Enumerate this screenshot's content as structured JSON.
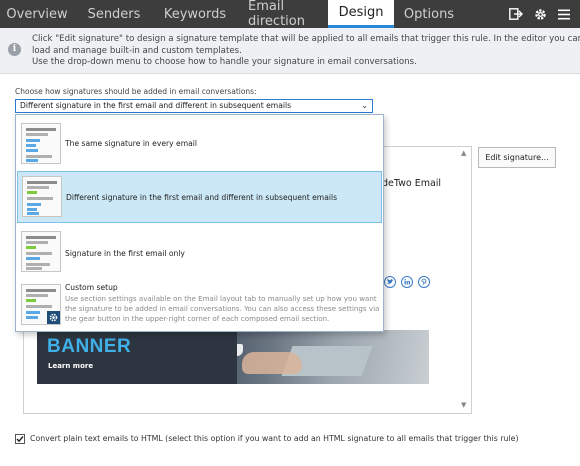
{
  "tabs": [
    {
      "label": "Overview"
    },
    {
      "label": "Senders"
    },
    {
      "label": "Keywords"
    },
    {
      "label": "Email direction"
    },
    {
      "label": "Design",
      "active": true
    },
    {
      "label": "Options"
    }
  ],
  "toolbar_icons": [
    "exit-icon",
    "gear-icon",
    "menu-icon"
  ],
  "info": {
    "line1": "Click \"Edit signature\" to design a signature template that will be applied to all emails that trigger this rule. In the editor you can also",
    "line2": "load and manage built-in and custom templates.",
    "line3": "Use the drop-down menu to choose how to handle your signature in email conversations."
  },
  "signature_mode": {
    "label": "Choose how signatures should be added in email conversations:",
    "selected": "Different signature in the first email and different in subsequent emails",
    "options": [
      {
        "label": "The same signature in every email"
      },
      {
        "label": "Different signature in the first email and different in subsequent emails"
      },
      {
        "label": "Signature in the first email only"
      },
      {
        "label": "Custom setup",
        "desc1": "Use section settings available on the Email layout tab to manually set up how you want",
        "desc2": "the signature to be added in email conversations. You can also access these settings via",
        "desc3": "the gear button in the upper-right corner of each composed email section."
      }
    ]
  },
  "preview": {
    "edit_button": "Edit signature...",
    "visible_text": "deTwo Email",
    "banner_title": "BANNER",
    "banner_sub": "Learn more"
  },
  "convert": {
    "checked": true,
    "label": "Convert plain text emails to HTML (select this option if you want to add an HTML signature to all emails that trigger this rule)"
  },
  "colors": {
    "accent": "#2b88d8",
    "topbar": "#3d3d3d",
    "selected_row": "#cce8f6",
    "banner_blue": "#3fb0e8"
  }
}
